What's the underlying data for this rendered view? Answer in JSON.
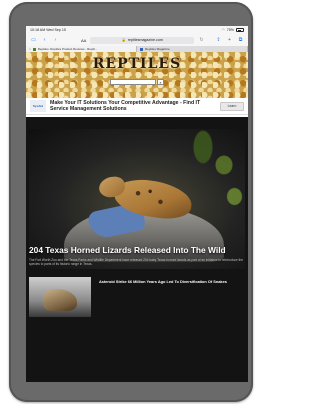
{
  "status_bar": {
    "time": "10:18 AM",
    "date": "Wed Sep 15",
    "battery": "75%"
  },
  "browser": {
    "aa": "AA",
    "url": "reptilesmagazine.com",
    "tabs": [
      {
        "label": "Reptiles: Reptiles Product Reviews - Reptil...",
        "active": true
      },
      {
        "label": "Reptiles Magazine",
        "active": false
      }
    ]
  },
  "site": {
    "logo": "REPTILES",
    "search": {
      "value": "",
      "placeholder": ""
    },
    "search_button": "⌕"
  },
  "ad": {
    "logo": "SysAid",
    "headline": "Make Your IT Solutions Your Competitive Advantage - Find IT Service Management Solutions",
    "cta": "Learn"
  },
  "main_story": {
    "headline": "204 Texas Horned Lizards Released Into The Wild",
    "summary": "The Fort Worth Zoo and the Texas Parks and Wildlife Department have released 204 baby Texas horned lizards as part of an initiative to reintroduce the species to parts of its historic range in Texas."
  },
  "secondary_story": {
    "headline": "Asteroid Strike 66 Million Years Ago Led To Diversification Of Snakes"
  },
  "colors": {
    "masthead": "#caa24a",
    "link_blue": "#1a73e8",
    "device": "#6a6a6a"
  }
}
